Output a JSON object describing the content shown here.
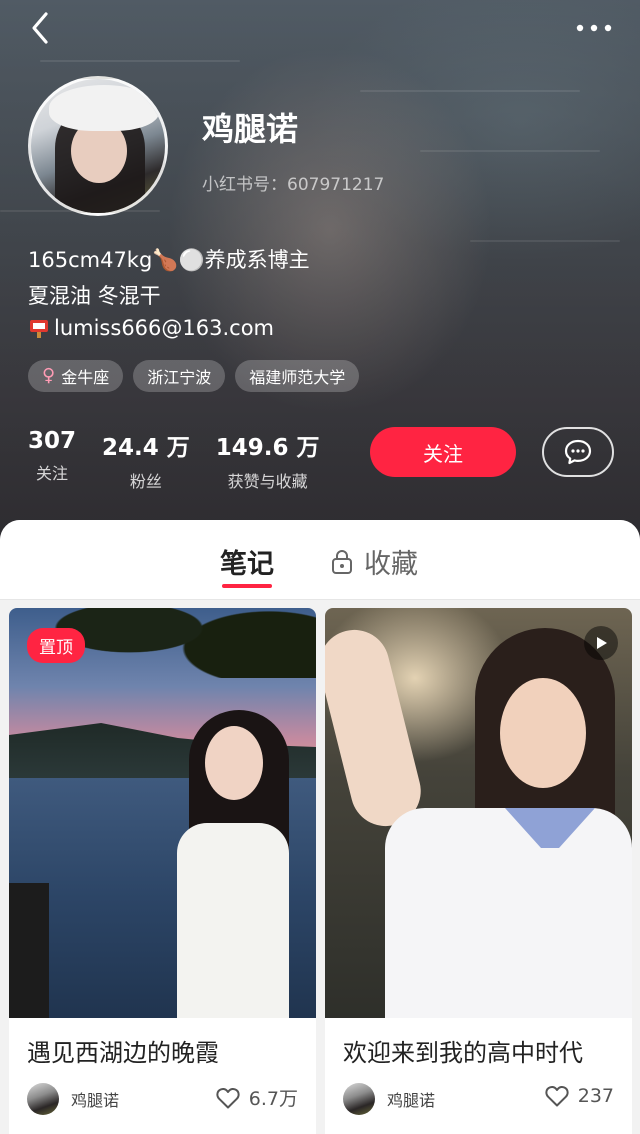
{
  "profile": {
    "name": "鸡腿诺",
    "red_id": "小红书号：607971217",
    "bio_lines": [
      "165cm47kg🍗⚪️养成系博主",
      "夏混油 冬混干"
    ],
    "email": "lumiss666@163.com",
    "tags": [
      "金牛座",
      "浙江宁波",
      "福建师范大学"
    ],
    "stats": [
      {
        "num": "307",
        "label": "关注"
      },
      {
        "num": "24.4 万",
        "label": "粉丝"
      },
      {
        "num": "149.6 万",
        "label": "获赞与收藏"
      }
    ],
    "follow_label": "关注"
  },
  "tabs": {
    "notes": "笔记",
    "collect": "收藏"
  },
  "posts": [
    {
      "badge": "置顶",
      "title": "遇见西湖边的晚霞",
      "author": "鸡腿诺",
      "likes": "6.7万"
    },
    {
      "title": "欢迎来到我的高中时代",
      "author": "鸡腿诺",
      "likes": "237"
    }
  ],
  "colors": {
    "accent": "#ff2442",
    "female": "#ff9cb5"
  },
  "icons": [
    "back-arrow-icon",
    "more-dots-icon",
    "female-icon",
    "mailbox-icon",
    "message-icon",
    "lock-icon",
    "heart-icon",
    "play-icon"
  ]
}
